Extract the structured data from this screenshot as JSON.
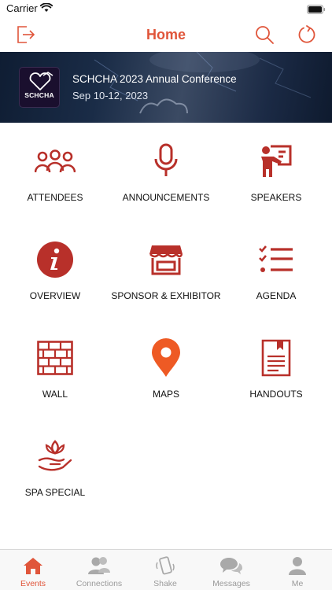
{
  "status_bar": {
    "carrier": "Carrier"
  },
  "header": {
    "title": "Home"
  },
  "event": {
    "logo_text": "SCHCHA",
    "title": "SCHCHA 2023 Annual Conference",
    "dates": "Sep 10-12, 2023"
  },
  "menu": {
    "attendees": "ATTENDEES",
    "announcements": "ANNOUNCEMENTS",
    "speakers": "SPEAKERS",
    "overview": "OVERVIEW",
    "sponsor": "SPONSOR & EXHIBITOR",
    "agenda": "AGENDA",
    "wall": "WALL",
    "maps": "MAPS",
    "handouts": "HANDOUTS",
    "spa": "SPA SPECIAL"
  },
  "tabs": {
    "events": "Events",
    "connections": "Connections",
    "shake": "Shake",
    "messages": "Messages",
    "me": "Me"
  },
  "colors": {
    "accent": "#e0553a",
    "icon_red": "#b8302a",
    "tab_inactive": "#9a9a9a"
  }
}
